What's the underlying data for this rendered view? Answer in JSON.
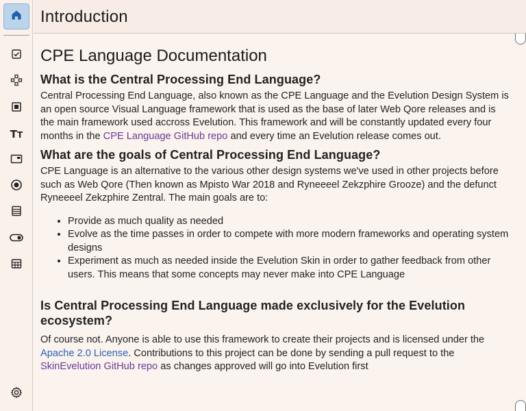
{
  "header": {
    "title": "Introduction"
  },
  "sidebar": {
    "items": [
      {
        "icon": "home-icon"
      },
      {
        "icon": "checkbox-icon"
      },
      {
        "icon": "components-icon"
      },
      {
        "icon": "square-button-icon"
      },
      {
        "icon": "typography-icon"
      },
      {
        "icon": "window-icon"
      },
      {
        "icon": "radio-icon"
      },
      {
        "icon": "list-icon"
      },
      {
        "icon": "toggle-icon"
      },
      {
        "icon": "table-icon"
      },
      {
        "icon": "settings-icon"
      }
    ]
  },
  "doc": {
    "title": "CPE Language Documentation",
    "sections": [
      {
        "heading": "What is the Central Processing End Language?",
        "text_before": "Central Processing End Language, also known as the CPE Language and the Evelution Design System is an open source Visual Language framework that is used as the base of later Web Qore releases and is the main framework used accross Evelution. This framework and will be constantly updated every four months in the ",
        "link": "CPE Language GitHub repo",
        "text_after": " and every time an Evelution release comes out."
      },
      {
        "heading": "What are the goals of Central Processing End Language?",
        "text": "CPE Language is an alternative to the various other design systems we've used in other projects before such as Web Qore (Then known as Mpisto War 2018 and Ryneeeel Zekzphire Grooze) and the defunct Ryneeeel Zekzphire Zentral. The main goals are to:",
        "goals": [
          "Provide as much quality as needed",
          "Evolve as the time passes in order to compete with more modern frameworks and operating system designs",
          "Experiment as much as needed inside the Evelution Skin in order to gather feedback from other users. This means that some concepts may never make into CPE Language"
        ]
      },
      {
        "heading": "Is Central Processing End Language made exclusively for the Evelution ecosystem?",
        "text_1": "Of course not. Anyone is able to use this framework to create their projects and is licensed under the ",
        "link_1": "Apache 2.0 License",
        "text_2": ". Contributions to this project can be done by sending a pull request to the ",
        "link_2": "SkinEvelution GitHub repo",
        "text_3": " as changes approved will go into Evelution first"
      }
    ]
  },
  "colors": {
    "accent_bg": "#bcd3ec",
    "link_purple": "#6b3a96",
    "link_blue": "#2a64b3",
    "page_bg": "#fbf3ee"
  }
}
